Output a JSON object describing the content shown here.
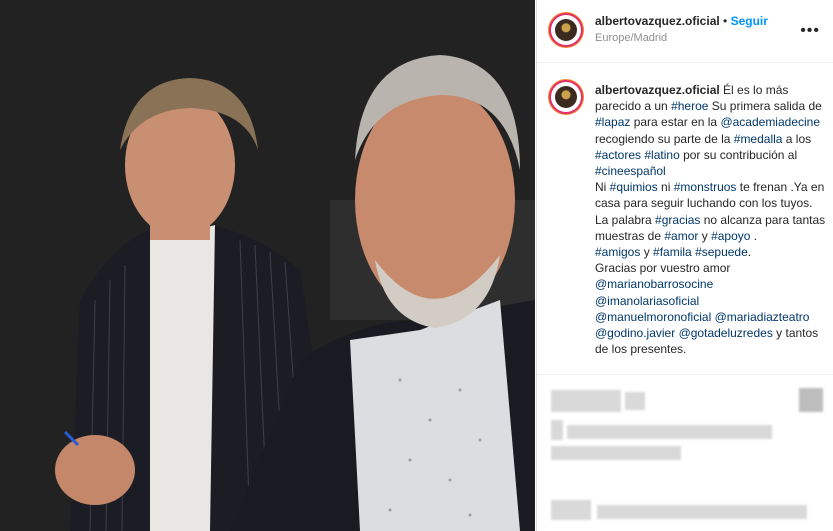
{
  "post": {
    "username": "albertovazquez.oficial",
    "follow_label": "Seguir",
    "location": "Europe/Madrid",
    "more_label": "•••"
  },
  "caption": {
    "username": "albertovazquez.oficial",
    "segments": [
      {
        "t": " Él es lo más parecido a un ",
        "tag": false
      },
      {
        "t": "#heroe",
        "tag": true
      },
      {
        "t": " Su primera salida de ",
        "tag": false
      },
      {
        "t": "#lapaz",
        "tag": true
      },
      {
        "t": " para estar en la ",
        "tag": false
      },
      {
        "t": "@academiadecine",
        "tag": true
      },
      {
        "t": " recogiendo su parte de la ",
        "tag": false
      },
      {
        "t": "#medalla",
        "tag": true
      },
      {
        "t": " a los ",
        "tag": false
      },
      {
        "t": "#actores",
        "tag": true
      },
      {
        "t": " ",
        "tag": false
      },
      {
        "t": "#latino",
        "tag": true
      },
      {
        "t": " por su contribución al ",
        "tag": false
      },
      {
        "t": "#cineespañol",
        "tag": true
      },
      {
        "t": "\nNi ",
        "tag": false
      },
      {
        "t": "#quimios",
        "tag": true
      },
      {
        "t": " ni ",
        "tag": false
      },
      {
        "t": "#monstruos",
        "tag": true
      },
      {
        "t": " te frenan .Ya en casa para seguir luchando con los tuyos.\nLa palabra ",
        "tag": false
      },
      {
        "t": "#gracias",
        "tag": true
      },
      {
        "t": " no alcanza para tantas muestras de ",
        "tag": false
      },
      {
        "t": "#amor",
        "tag": true
      },
      {
        "t": " y ",
        "tag": false
      },
      {
        "t": "#apoyo",
        "tag": true
      },
      {
        "t": " .\n",
        "tag": false
      },
      {
        "t": "#amigos",
        "tag": true
      },
      {
        "t": " y ",
        "tag": false
      },
      {
        "t": "#famila",
        "tag": true
      },
      {
        "t": " ",
        "tag": false
      },
      {
        "t": "#sepuede",
        "tag": true
      },
      {
        "t": ".\nGracias por vuestro amor\n",
        "tag": false
      },
      {
        "t": "@marianobarrosocine",
        "tag": true
      },
      {
        "t": "\n",
        "tag": false
      },
      {
        "t": "@imanolariasoficial",
        "tag": true
      },
      {
        "t": "\n",
        "tag": false
      },
      {
        "t": "@manuelmoronoficial",
        "tag": true
      },
      {
        "t": " ",
        "tag": false
      },
      {
        "t": "@mariadiazteatro",
        "tag": true
      },
      {
        "t": "\n",
        "tag": false
      },
      {
        "t": "@godino.javier",
        "tag": true
      },
      {
        "t": " ",
        "tag": false
      },
      {
        "t": "@gotadeluzredes",
        "tag": true
      },
      {
        "t": " y tantos de los presentes.",
        "tag": false
      }
    ]
  },
  "colors": {
    "link": "#00376b",
    "follow": "#0095f6",
    "muted": "#8e8e8e"
  }
}
